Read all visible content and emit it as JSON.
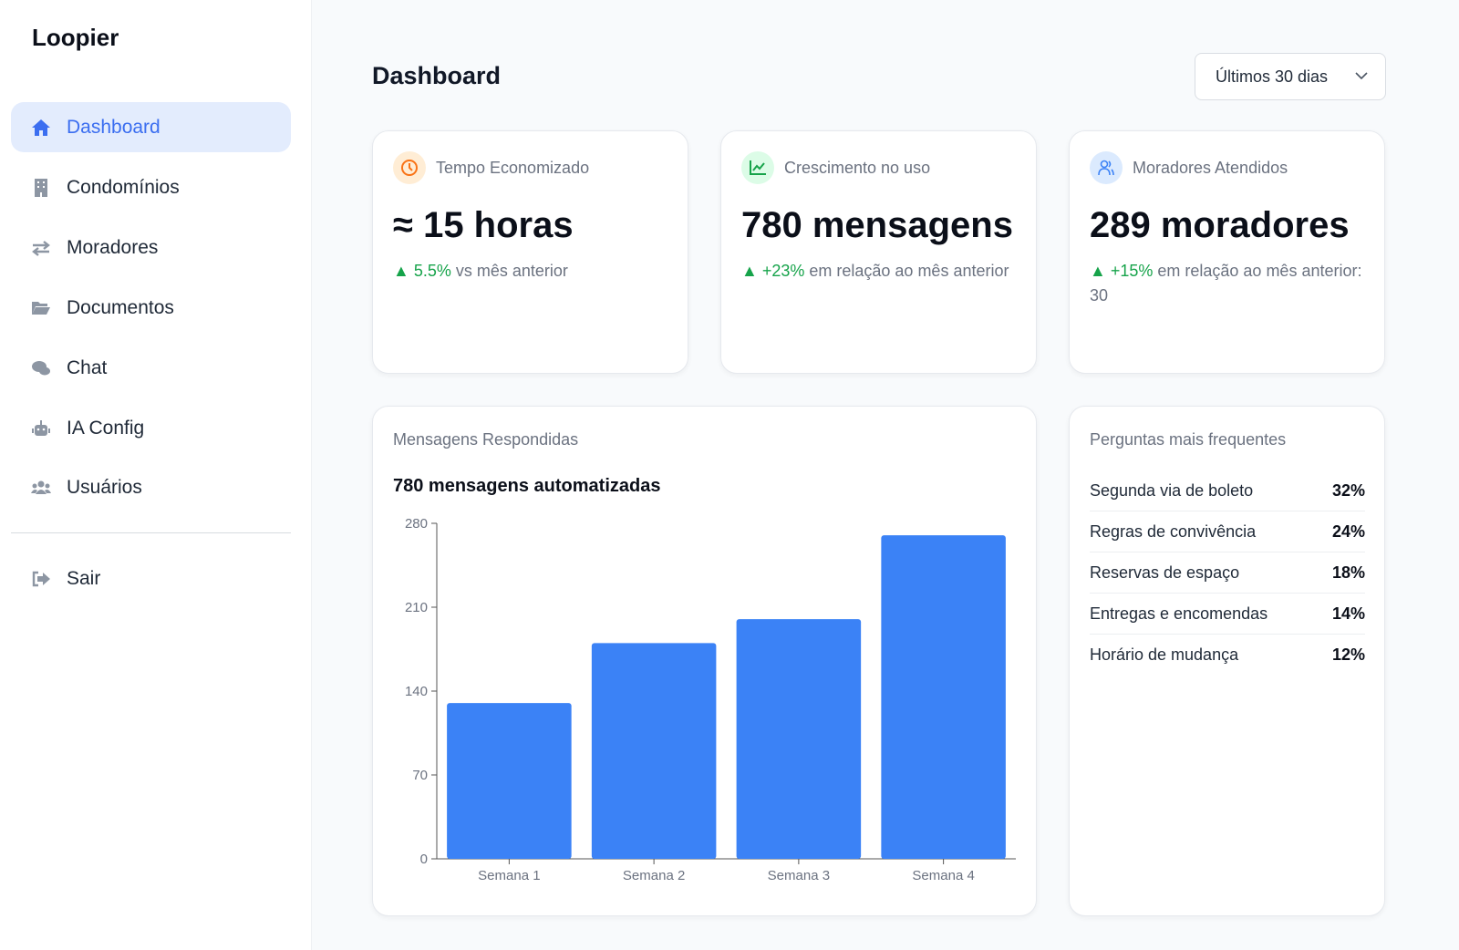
{
  "app": {
    "name": "Loopier"
  },
  "sidebar": {
    "items": [
      {
        "label": "Dashboard",
        "icon": "home-icon",
        "active": true
      },
      {
        "label": "Condomínios",
        "icon": "building-icon"
      },
      {
        "label": "Moradores",
        "icon": "arrows-exchange-icon"
      },
      {
        "label": "Documentos",
        "icon": "folder-open-icon"
      },
      {
        "label": "Chat",
        "icon": "comments-icon"
      },
      {
        "label": "IA Config",
        "icon": "robot-icon"
      },
      {
        "label": "Usuários",
        "icon": "users-icon"
      }
    ],
    "logout": {
      "label": "Sair",
      "icon": "sign-out-icon"
    }
  },
  "header": {
    "title": "Dashboard",
    "period": "Últimos 30 dias"
  },
  "kpis": [
    {
      "label": "Tempo Economizado",
      "value": "≈ 15 horas",
      "delta": "5.5%",
      "delta_text": " vs mês anterior",
      "color": "#f97316"
    },
    {
      "label": "Crescimento no uso",
      "value": "780 mensagens",
      "delta": "+23%",
      "delta_text": " em relação ao mês anterior",
      "color": "#16a34a"
    },
    {
      "label": "Moradores Atendidos",
      "value": "289 moradores",
      "delta": "+15%",
      "delta_text": " em relação ao mês anterior: 30",
      "color": "#3b82f6"
    }
  ],
  "chart_card": {
    "label": "Mensagens Respondidas",
    "subtitle": "780 mensagens automatizadas"
  },
  "chart_data": {
    "type": "bar",
    "categories": [
      "Semana 1",
      "Semana 2",
      "Semana 3",
      "Semana 4"
    ],
    "values": [
      130,
      180,
      200,
      270
    ],
    "ylim": [
      0,
      280
    ],
    "yticks": [
      0,
      70,
      140,
      210,
      280
    ],
    "color": "#3b82f6",
    "title": "780 mensagens automatizadas",
    "xlabel": "",
    "ylabel": ""
  },
  "faq": {
    "title": "Perguntas mais frequentes",
    "items": [
      {
        "q": "Segunda via de boleto",
        "pct": "32%"
      },
      {
        "q": "Regras de convivência",
        "pct": "24%"
      },
      {
        "q": "Reservas de espaço",
        "pct": "18%"
      },
      {
        "q": "Entregas e encomendas",
        "pct": "14%"
      },
      {
        "q": "Horário de mudança",
        "pct": "12%"
      }
    ]
  }
}
